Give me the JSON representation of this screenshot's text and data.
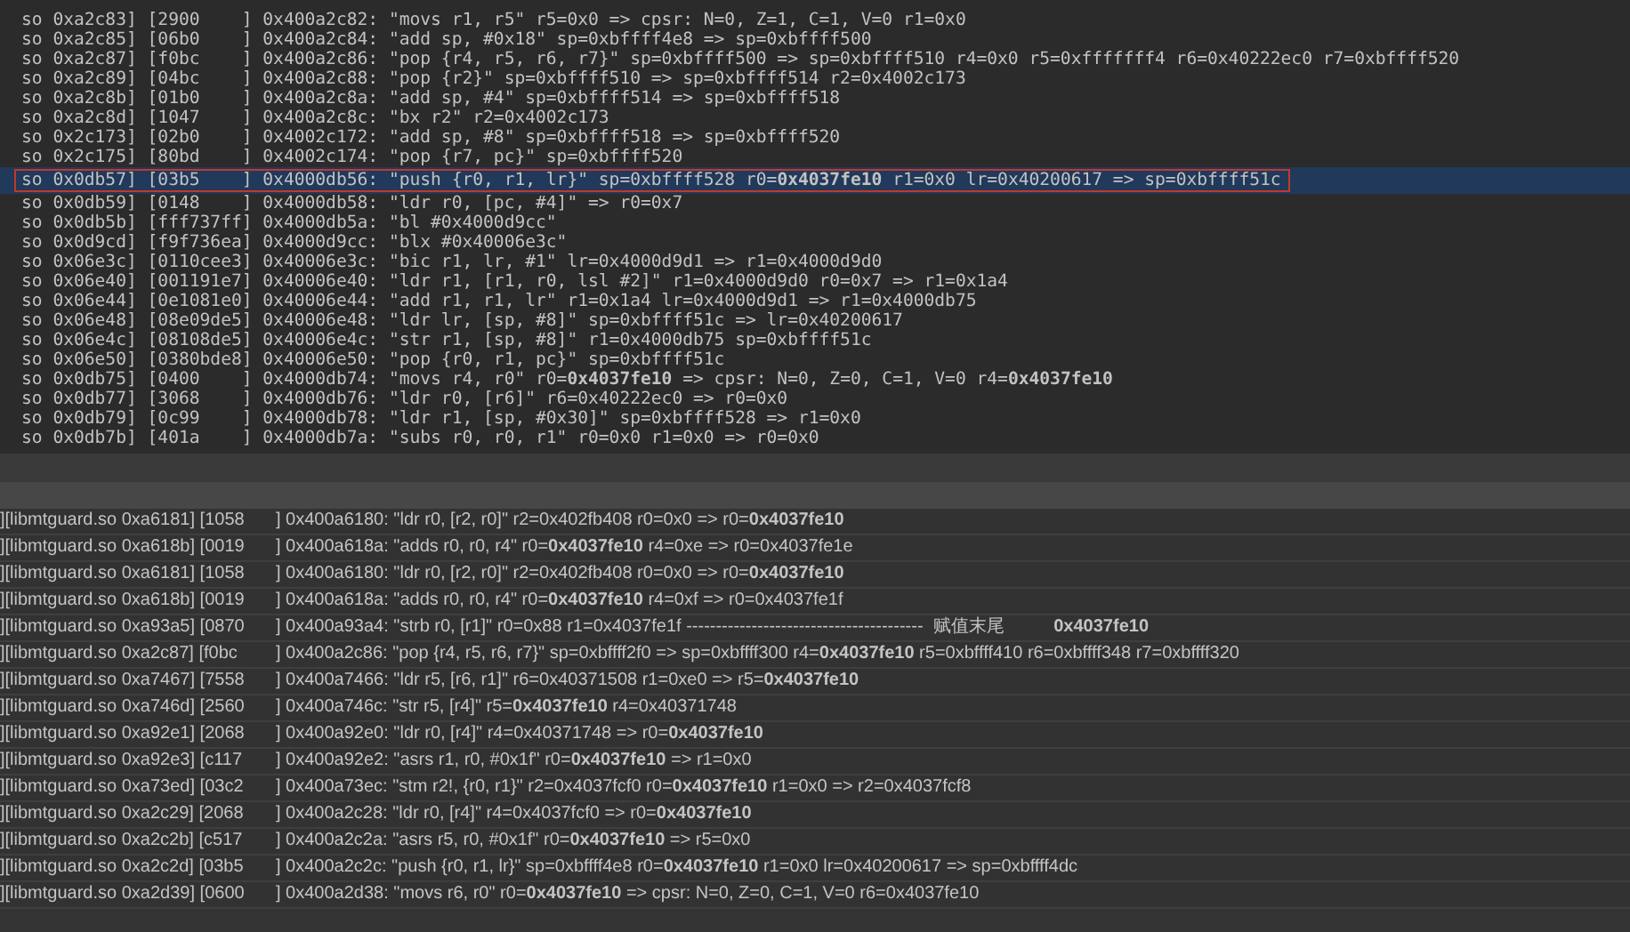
{
  "trace_view": {
    "rows": [
      {
        "text": "so 0xa2c83] [2900    ] 0x400a2c82: \"movs r1, r5\" r5=0x0 => cpsr: N=0, Z=1, C=1, V=0 r1=0x0",
        "selected": false,
        "marked": false
      },
      {
        "text": "so 0xa2c85] [06b0    ] 0x400a2c84: \"add sp, #0x18\" sp=0xbffff4e8 => sp=0xbffff500",
        "selected": false,
        "marked": false
      },
      {
        "text": "so 0xa2c87] [f0bc    ] 0x400a2c86: \"pop {r4, r5, r6, r7}\" sp=0xbffff500 => sp=0xbffff510 r4=0x0 r5=0xfffffff4 r6=0x40222ec0 r7=0xbffff520",
        "selected": false,
        "marked": false
      },
      {
        "text": "so 0xa2c89] [04bc    ] 0x400a2c88: \"pop {r2}\" sp=0xbffff510 => sp=0xbffff514 r2=0x4002c173",
        "selected": false,
        "marked": false
      },
      {
        "text": "so 0xa2c8b] [01b0    ] 0x400a2c8a: \"add sp, #4\" sp=0xbffff514 => sp=0xbffff518",
        "selected": false,
        "marked": false
      },
      {
        "text": "so 0xa2c8d] [1047    ] 0x400a2c8c: \"bx r2\" r2=0x4002c173",
        "selected": false,
        "marked": false
      },
      {
        "text": "so 0x2c173] [02b0    ] 0x4002c172: \"add sp, #8\" sp=0xbffff518 => sp=0xbffff520",
        "selected": false,
        "marked": false
      },
      {
        "text": "so 0x2c175] [80bd    ] 0x4002c174: \"pop {r7, pc}\" sp=0xbffff520",
        "selected": false,
        "marked": false
      },
      {
        "text": "so 0x0db57] [03b5    ] 0x4000db56: \"push {r0, r1, lr}\" sp=0xbffff528 r0=**0x4037fe10** r1=0x0 lr=0x40200617 => sp=0xbffff51c",
        "selected": true,
        "marked": true
      },
      {
        "text": "so 0x0db59] [0148    ] 0x4000db58: \"ldr r0, [pc, #4]\" => r0=0x7",
        "selected": false,
        "marked": false
      },
      {
        "text": "so 0x0db5b] [fff737ff] 0x4000db5a: \"bl #0x4000d9cc\"",
        "selected": false,
        "marked": false
      },
      {
        "text": "so 0x0d9cd] [f9f736ea] 0x4000d9cc: \"blx #0x40006e3c\"",
        "selected": false,
        "marked": false
      },
      {
        "text": "so 0x06e3c] [0110cee3] 0x40006e3c: \"bic r1, lr, #1\" lr=0x4000d9d1 => r1=0x4000d9d0",
        "selected": false,
        "marked": false
      },
      {
        "text": "so 0x06e40] [001191e7] 0x40006e40: \"ldr r1, [r1, r0, lsl #2]\" r1=0x4000d9d0 r0=0x7 => r1=0x1a4",
        "selected": false,
        "marked": false
      },
      {
        "text": "so 0x06e44] [0e1081e0] 0x40006e44: \"add r1, r1, lr\" r1=0x1a4 lr=0x4000d9d1 => r1=0x4000db75",
        "selected": false,
        "marked": false
      },
      {
        "text": "so 0x06e48] [08e09de5] 0x40006e48: \"ldr lr, [sp, #8]\" sp=0xbffff51c => lr=0x40200617",
        "selected": false,
        "marked": false
      },
      {
        "text": "so 0x06e4c] [08108de5] 0x40006e4c: \"str r1, [sp, #8]\" r1=0x4000db75 sp=0xbffff51c",
        "selected": false,
        "marked": false
      },
      {
        "text": "so 0x06e50] [0380bde8] 0x40006e50: \"pop {r0, r1, pc}\" sp=0xbffff51c",
        "selected": false,
        "marked": false
      },
      {
        "text": "so 0x0db75] [0400    ] 0x4000db74: \"movs r4, r0\" r0=**0x4037fe10** => cpsr: N=0, Z=0, C=1, V=0 r4=**0x4037fe10**",
        "selected": false,
        "marked": false
      },
      {
        "text": "so 0x0db77] [3068    ] 0x4000db76: \"ldr r0, [r6]\" r6=0x40222ec0 => r0=0x0",
        "selected": false,
        "marked": false
      },
      {
        "text": "so 0x0db79] [0c99    ] 0x4000db78: \"ldr r1, [sp, #0x30]\" sp=0xbffff528 => r1=0x0",
        "selected": false,
        "marked": false
      },
      {
        "text": "so 0x0db7b] [401a    ] 0x4000db7a: \"subs r0, r0, r1\" r0=0x0 r1=0x0 => r0=0x0",
        "selected": false,
        "marked": false
      }
    ]
  },
  "log_table": {
    "rows": [
      {
        "location": "][libmtguard.so 0xa6181] [1058",
        "instruction": "] 0x400a6180: \"ldr r0, [r2, r0]\" r2=0x402fb408 r0=0x0 => r0=**0x4037fe10**"
      },
      {
        "location": "][libmtguard.so 0xa618b] [0019",
        "instruction": "] 0x400a618a: \"adds r0, r0, r4\" r0=**0x4037fe10** r4=0xe => r0=0x4037fe1e"
      },
      {
        "location": "][libmtguard.so 0xa6181] [1058",
        "instruction": "] 0x400a6180: \"ldr r0, [r2, r0]\" r2=0x402fb408 r0=0x0 => r0=**0x4037fe10**"
      },
      {
        "location": "][libmtguard.so 0xa618b] [0019",
        "instruction": "] 0x400a618a: \"adds r0, r0, r4\" r0=**0x4037fe10** r4=0xf => r0=0x4037fe1f"
      },
      {
        "location": "][libmtguard.so 0xa93a5] [0870",
        "instruction": "] 0x400a93a4: \"strb r0, [r1]\" r0=0x88 r1=0x4037fe1f ----------------------------------------  赋值末尾          **0x4037fe10**"
      },
      {
        "location": "][libmtguard.so 0xa2c87] [f0bc",
        "instruction": "] 0x400a2c86: \"pop {r4, r5, r6, r7}\" sp=0xbffff2f0 => sp=0xbffff300 r4=**0x4037fe10** r5=0xbffff410 r6=0xbffff348 r7=0xbffff320"
      },
      {
        "location": "][libmtguard.so 0xa7467] [7558",
        "instruction": "] 0x400a7466: \"ldr r5, [r6, r1]\" r6=0x40371508 r1=0xe0 => r5=**0x4037fe10**"
      },
      {
        "location": "][libmtguard.so 0xa746d] [2560",
        "instruction": "] 0x400a746c: \"str r5, [r4]\" r5=**0x4037fe10** r4=0x40371748"
      },
      {
        "location": "][libmtguard.so 0xa92e1] [2068",
        "instruction": "] 0x400a92e0: \"ldr r0, [r4]\" r4=0x40371748 => r0=**0x4037fe10**"
      },
      {
        "location": "][libmtguard.so 0xa92e3] [c117",
        "instruction": "] 0x400a92e2: \"asrs r1, r0, #0x1f\" r0=**0x4037fe10** => r1=0x0"
      },
      {
        "location": "][libmtguard.so 0xa73ed] [03c2",
        "instruction": "] 0x400a73ec: \"stm r2!, {r0, r1}\" r2=0x4037fcf0 r0=**0x4037fe10** r1=0x0 => r2=0x4037fcf8"
      },
      {
        "location": "][libmtguard.so 0xa2c29] [2068",
        "instruction": "] 0x400a2c28: \"ldr r0, [r4]\" r4=0x4037fcf0 => r0=**0x4037fe10**"
      },
      {
        "location": "][libmtguard.so 0xa2c2b] [c517",
        "instruction": "] 0x400a2c2a: \"asrs r5, r0, #0x1f\" r0=**0x4037fe10** => r5=0x0"
      },
      {
        "location": "][libmtguard.so 0xa2c2d] [03b5",
        "instruction": "] 0x400a2c2c: \"push {r0, r1, lr}\" sp=0xbffff4e8 r0=**0x4037fe10** r1=0x0 lr=0x40200617 => sp=0xbffff4dc"
      },
      {
        "location": "][libmtguard.so 0xa2d39] [0600",
        "instruction": "] 0x400a2d38: \"movs r6, r0\" r0=**0x4037fe10** => cpsr: N=0, Z=0, C=1, V=0 r6=0x4037fe10"
      }
    ]
  }
}
